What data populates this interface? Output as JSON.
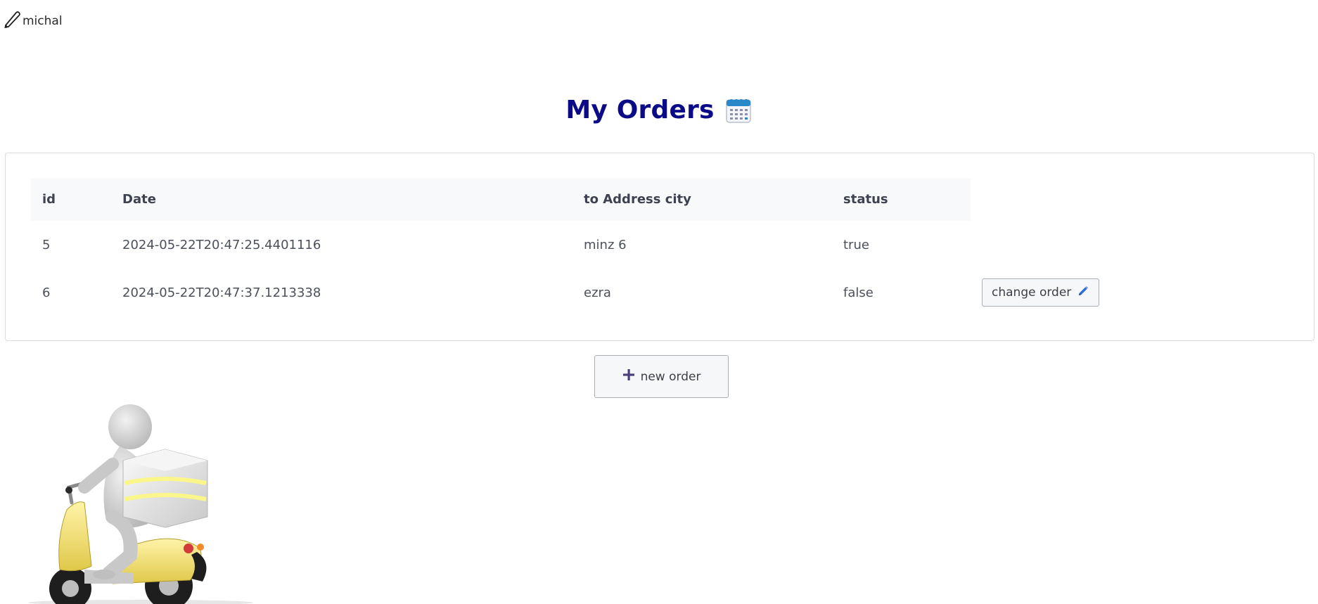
{
  "user": {
    "name": "michal",
    "icon": "pencil-icon"
  },
  "page": {
    "title": "My Orders",
    "title_icon": "calendar-icon",
    "title_color": "#0b0b87"
  },
  "orders_table": {
    "headers": [
      "id",
      "Date",
      "to Address city",
      "status"
    ],
    "rows": [
      {
        "id": "5",
        "date": "2024-05-22T20:47:25.4401116",
        "city": "minz 6",
        "status": "true",
        "action": ""
      },
      {
        "id": "6",
        "date": "2024-05-22T20:47:37.1213338",
        "city": "ezra",
        "status": "false",
        "action": "change order"
      }
    ],
    "action_icon": "pencil-icon"
  },
  "new_order_button": {
    "label": "new order",
    "icon": "plus-icon"
  },
  "illustration": {
    "icon": "delivery-scooter-figure"
  }
}
